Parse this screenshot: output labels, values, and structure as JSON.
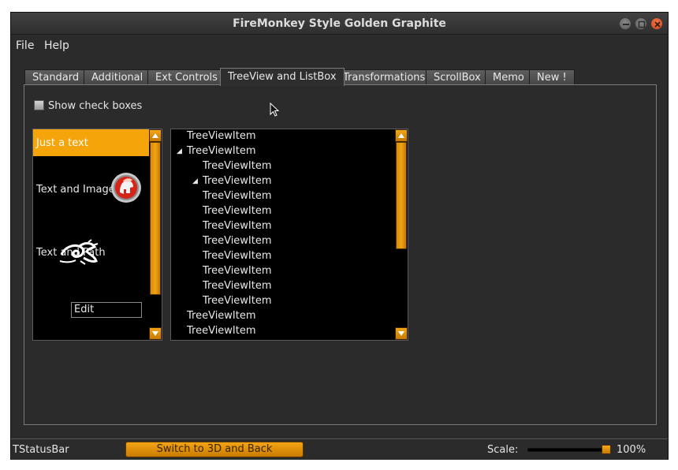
{
  "window": {
    "title": "FireMonkey Style Golden Graphite"
  },
  "menu": {
    "items": [
      "File",
      "Help"
    ]
  },
  "tabs": [
    {
      "label": "Standard",
      "active": false
    },
    {
      "label": "Additional",
      "active": false
    },
    {
      "label": "Ext Controls",
      "active": false
    },
    {
      "label": "TreeView and ListBox",
      "active": true
    },
    {
      "label": "Transformations",
      "active": false
    },
    {
      "label": "ScrollBox",
      "active": false
    },
    {
      "label": "Memo",
      "active": false
    },
    {
      "label": "New !",
      "active": false
    }
  ],
  "page": {
    "show_checkboxes": {
      "label": "Show check boxes",
      "checked": false
    },
    "listbox": {
      "items": [
        {
          "label": "Just a text",
          "selected": true,
          "icon": ""
        },
        {
          "label": "Text and Image",
          "selected": false,
          "icon": "spartan-helmet-icon"
        },
        {
          "label": "Text and Path",
          "selected": false,
          "icon": "dragon-path-icon"
        }
      ],
      "edit_value": "Edit"
    },
    "treeview": {
      "rows": [
        {
          "label": "TreeViewItem",
          "level": 0,
          "expanded": null
        },
        {
          "label": "TreeViewItem",
          "level": 0,
          "expanded": true
        },
        {
          "label": "TreeViewItem",
          "level": 1,
          "expanded": null
        },
        {
          "label": "TreeViewItem",
          "level": 1,
          "expanded": true
        },
        {
          "label": "TreeViewItem",
          "level": 1,
          "expanded": null
        },
        {
          "label": "TreeViewItem",
          "level": 1,
          "expanded": null
        },
        {
          "label": "TreeViewItem",
          "level": 1,
          "expanded": null
        },
        {
          "label": "TreeViewItem",
          "level": 1,
          "expanded": null
        },
        {
          "label": "TreeViewItem",
          "level": 1,
          "expanded": null
        },
        {
          "label": "TreeViewItem",
          "level": 1,
          "expanded": null
        },
        {
          "label": "TreeViewItem",
          "level": 1,
          "expanded": null
        },
        {
          "label": "TreeViewItem",
          "level": 1,
          "expanded": null
        },
        {
          "label": "TreeViewItem",
          "level": 0,
          "expanded": null
        },
        {
          "label": "TreeViewItem",
          "level": 0,
          "expanded": null
        }
      ]
    }
  },
  "statusbar": {
    "text": "TStatusBar",
    "switch_button": "Switch to 3D and Back",
    "scale_label": "Scale:",
    "scale_value": "100%",
    "scale_level": 1.0
  },
  "colors": {
    "accent": "#f5a40a",
    "background": "#2b2b2b",
    "control_bg": "#000000"
  }
}
